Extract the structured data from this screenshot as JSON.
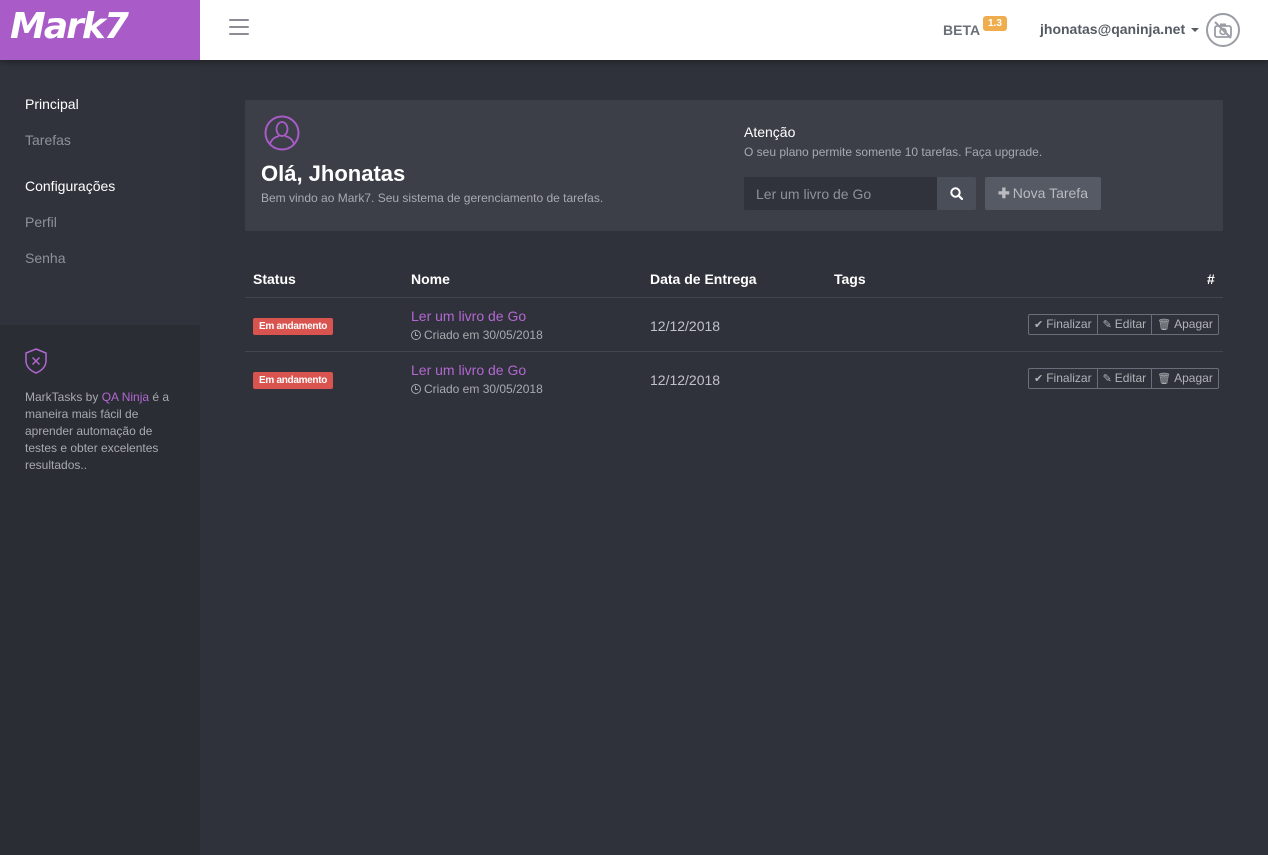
{
  "header": {
    "brand": "Mark7",
    "beta_label": "BETA",
    "version": "1.3",
    "user_email": "jhonatas@qaninja.net"
  },
  "sidebar": {
    "sections": [
      {
        "heading": "Principal",
        "items": [
          "Tarefas"
        ]
      },
      {
        "heading": "Configurações",
        "items": [
          "Perfil",
          "Senha"
        ]
      }
    ],
    "info_prefix": "MarkTasks by ",
    "info_link": "QA Ninja",
    "info_suffix": " é a maneira mais fácil de aprender automação de testes e obter excelentes resultados.."
  },
  "panel": {
    "greeting": "Olá, Jhonatas",
    "welcome": "Bem vindo ao Mark7. Seu sistema de gerenciamento de tarefas.",
    "attention_title": "Atenção",
    "attention_text": "O seu plano permite somente 10 tarefas. Faça upgrade.",
    "search_value": "",
    "search_placeholder": "Ler um livro de Go",
    "new_task_label": "Nova Tarefa"
  },
  "table": {
    "headers": [
      "Status",
      "Nome",
      "Data de Entrega",
      "Tags",
      "#"
    ],
    "rows": [
      {
        "status": "Em andamento",
        "name": "Ler um livro de Go",
        "created": "Criado em 30/05/2018",
        "due": "12/12/2018",
        "tags": ""
      },
      {
        "status": "Em andamento",
        "name": "Ler um livro de Go",
        "created": "Criado em 30/05/2018",
        "due": "12/12/2018",
        "tags": ""
      }
    ],
    "actions": {
      "finish": "Finalizar",
      "edit": "Editar",
      "delete": "Apagar"
    }
  },
  "colors": {
    "brand": "#a95cc7",
    "accent_link": "#b267d1",
    "status_badge": "#d9534f",
    "version_badge": "#f0ad4e",
    "background": "#2f323a"
  }
}
